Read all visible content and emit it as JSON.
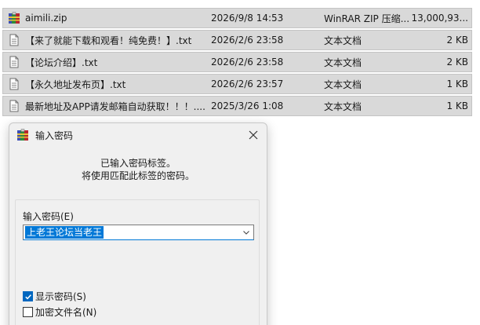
{
  "files": [
    {
      "name": "aimili.zip",
      "date": "2026/9/8 14:53",
      "type": "WinRAR ZIP 压缩...",
      "size": "13,000,93...",
      "icon": "winrar-archive-icon"
    },
    {
      "name": "【来了就能下载和观看！纯免费！】.txt",
      "date": "2026/2/6 23:58",
      "type": "文本文档",
      "size": "2 KB",
      "icon": "text-file-icon"
    },
    {
      "name": "【论坛介绍】.txt",
      "date": "2026/2/6 23:58",
      "type": "文本文档",
      "size": "2 KB",
      "icon": "text-file-icon"
    },
    {
      "name": "【永久地址发布页】.txt",
      "date": "2026/2/6 23:57",
      "type": "文本文档",
      "size": "1 KB",
      "icon": "text-file-icon"
    },
    {
      "name": "最新地址及APP请发邮箱自动获取！！！....",
      "date": "2025/3/26 1:08",
      "type": "文本文档",
      "size": "1 KB",
      "icon": "text-file-icon"
    }
  ],
  "dialog": {
    "title": "输入密码",
    "message_line1": "已输入密码标签。",
    "message_line2": "将使用匹配此标签的密码。",
    "password_label": "输入密码(E)",
    "password_value": "上老王论坛当老王",
    "show_password_label": "显示密码(S)",
    "show_password_checked": true,
    "encrypt_filenames_label": "加密文件名(N)",
    "encrypt_filenames_checked": false
  }
}
